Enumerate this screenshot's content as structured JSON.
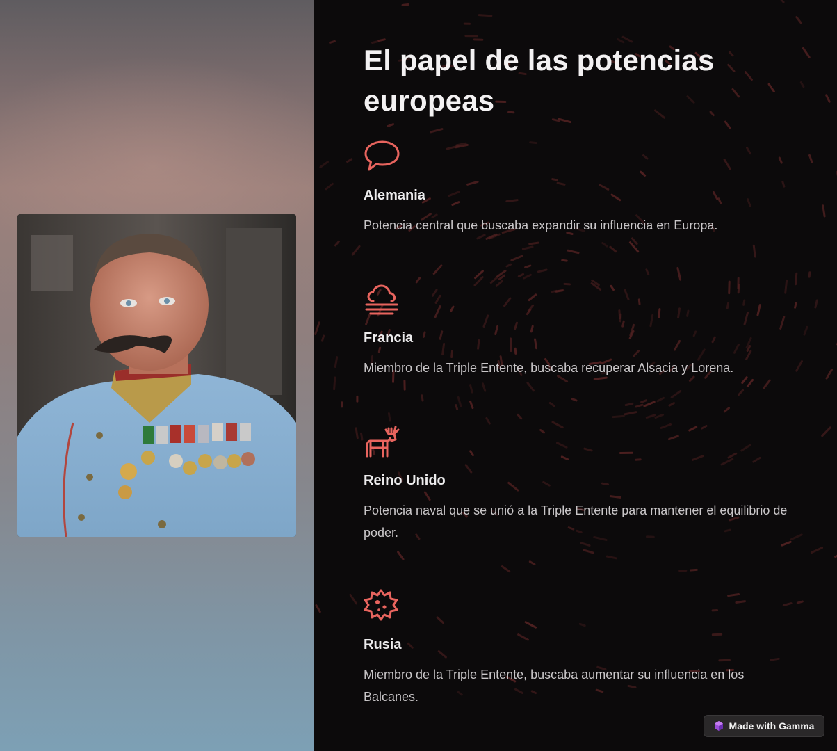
{
  "title": "El papel de las potencias europeas",
  "items": [
    {
      "icon": "speech-bubble-icon",
      "name": "Alemania",
      "description": "Potencia central que buscaba expandir su influencia en Europa."
    },
    {
      "icon": "cloud-fog-icon",
      "name": "Francia",
      "description": "Miembro de la Triple Entente, buscaba recuperar Alsacia y Lorena."
    },
    {
      "icon": "moose-icon",
      "name": "Reino Unido",
      "description": "Potencia naval que se unió a la Triple Entente para mantener el equilibrio de poder."
    },
    {
      "icon": "virus-icon",
      "name": "Rusia",
      "description": "Miembro de la Triple Entente, buscaba aumentar su influencia en los Balcanes."
    }
  ],
  "badge": {
    "label": "Made with Gamma",
    "icon": "gamma-gem-icon"
  },
  "colors": {
    "accent": "#e8645e",
    "background": "#0c0a0b",
    "text": "#f3f1f2",
    "muted": "#c9c6c8"
  }
}
